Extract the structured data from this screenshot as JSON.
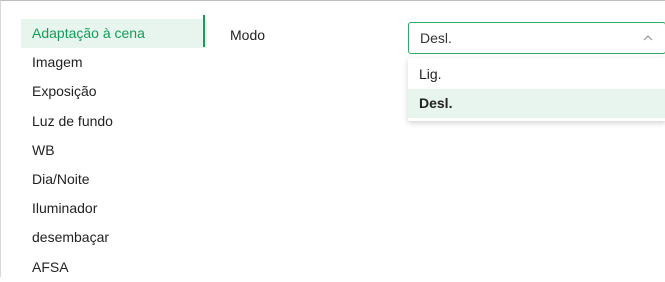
{
  "sidebar": {
    "items": [
      {
        "label": "Adaptação à cena",
        "active": true
      },
      {
        "label": "Imagem"
      },
      {
        "label": "Exposição"
      },
      {
        "label": "Luz de fundo"
      },
      {
        "label": "WB"
      },
      {
        "label": "Dia/Noite"
      },
      {
        "label": "Iluminador"
      },
      {
        "label": "desembaçar"
      },
      {
        "label": "AFSA"
      }
    ]
  },
  "form": {
    "mode_label": "Modo",
    "mode_select": {
      "value": "Desl.",
      "icon": "chevron-up-icon",
      "options": [
        "Lig.",
        "Desl."
      ],
      "selected": "Desl."
    }
  },
  "colors": {
    "accent": "#1a9b57",
    "active_bg": "#e7f5ee"
  }
}
